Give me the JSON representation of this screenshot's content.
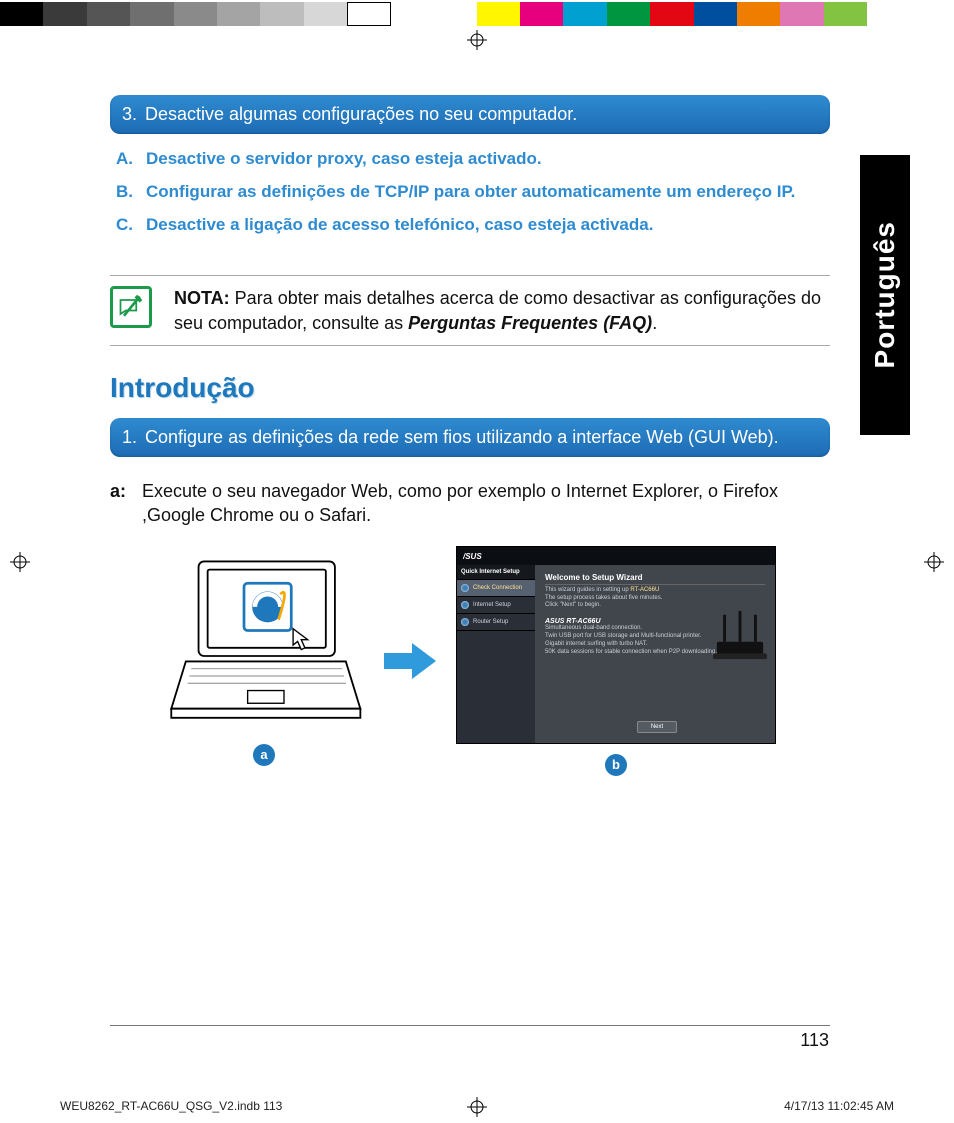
{
  "colorbar": [
    "#000",
    "#3a3a3a",
    "#555",
    "#6f6f6f",
    "#8a8a8a",
    "#a4a4a4",
    "#bdbdbd",
    "#d7d7d7",
    "#fff",
    "#fff",
    "#fff",
    "#fff600",
    "#e6007e",
    "#00a0d1",
    "#009640",
    "#e30613",
    "#004f9f",
    "#ef7d00",
    "#e077b5",
    "#82c341",
    "#fff",
    "#fff"
  ],
  "langTab": "Português",
  "step3": {
    "num": "3.",
    "text": "Desactive algumas configurações no seu computador."
  },
  "subA": {
    "lbl": "A.",
    "text": "Desactive o servidor proxy, caso esteja activado."
  },
  "subB": {
    "lbl": "B.",
    "text": "Configurar as definições de TCP/IP para obter automaticamente um endereço IP."
  },
  "subC": {
    "lbl": "C.",
    "text": "Desactive a ligação de acesso telefónico, caso esteja activada."
  },
  "note": {
    "label": "NOTA:",
    "body": "Para obter mais detalhes acerca de como desactivar as configurações do seu computador, consulte as ",
    "bold": "Perguntas Frequentes (FAQ)",
    "tail": "."
  },
  "sectionTitle": "Introdução",
  "step1": {
    "num": "1.",
    "text": "Configure as definições da rede sem fios utilizando a interface Web (GUI Web)."
  },
  "bodyA": {
    "lbl": "a:",
    "text": "Execute o seu navegador Web, como por exemplo o Internet Explorer, o Firefox ,Google Chrome ou o Safari."
  },
  "badges": {
    "a": "a",
    "b": "b"
  },
  "wizard": {
    "brand": "ASUS",
    "sideHead": "Quick Internet Setup",
    "side1": "Check Connection",
    "side2": "Internet Setup",
    "side3": "Router Setup",
    "title": "Welcome to Setup Wizard",
    "line1a": "This wizard guides in setting up ",
    "line1b": "RT-AC66U",
    "line2": "The setup process takes about five minutes.",
    "line3": "Click \"Next\" to begin.",
    "model": "ASUS RT-AC66U",
    "feat1": "Simultaneous dual-band connection.",
    "feat2": "Twin USB port for USB storage and Multi-functional printer.",
    "feat3": "Gigabit internet surfing with turbo NAT.",
    "feat4": "50K data sessions for stable connection when P2P downloading.",
    "btn": "Next"
  },
  "pageNumber": "113",
  "slugLeft": "WEU8262_RT-AC66U_QSG_V2.indb   113",
  "slugRight": "4/17/13   11:02:45 AM"
}
